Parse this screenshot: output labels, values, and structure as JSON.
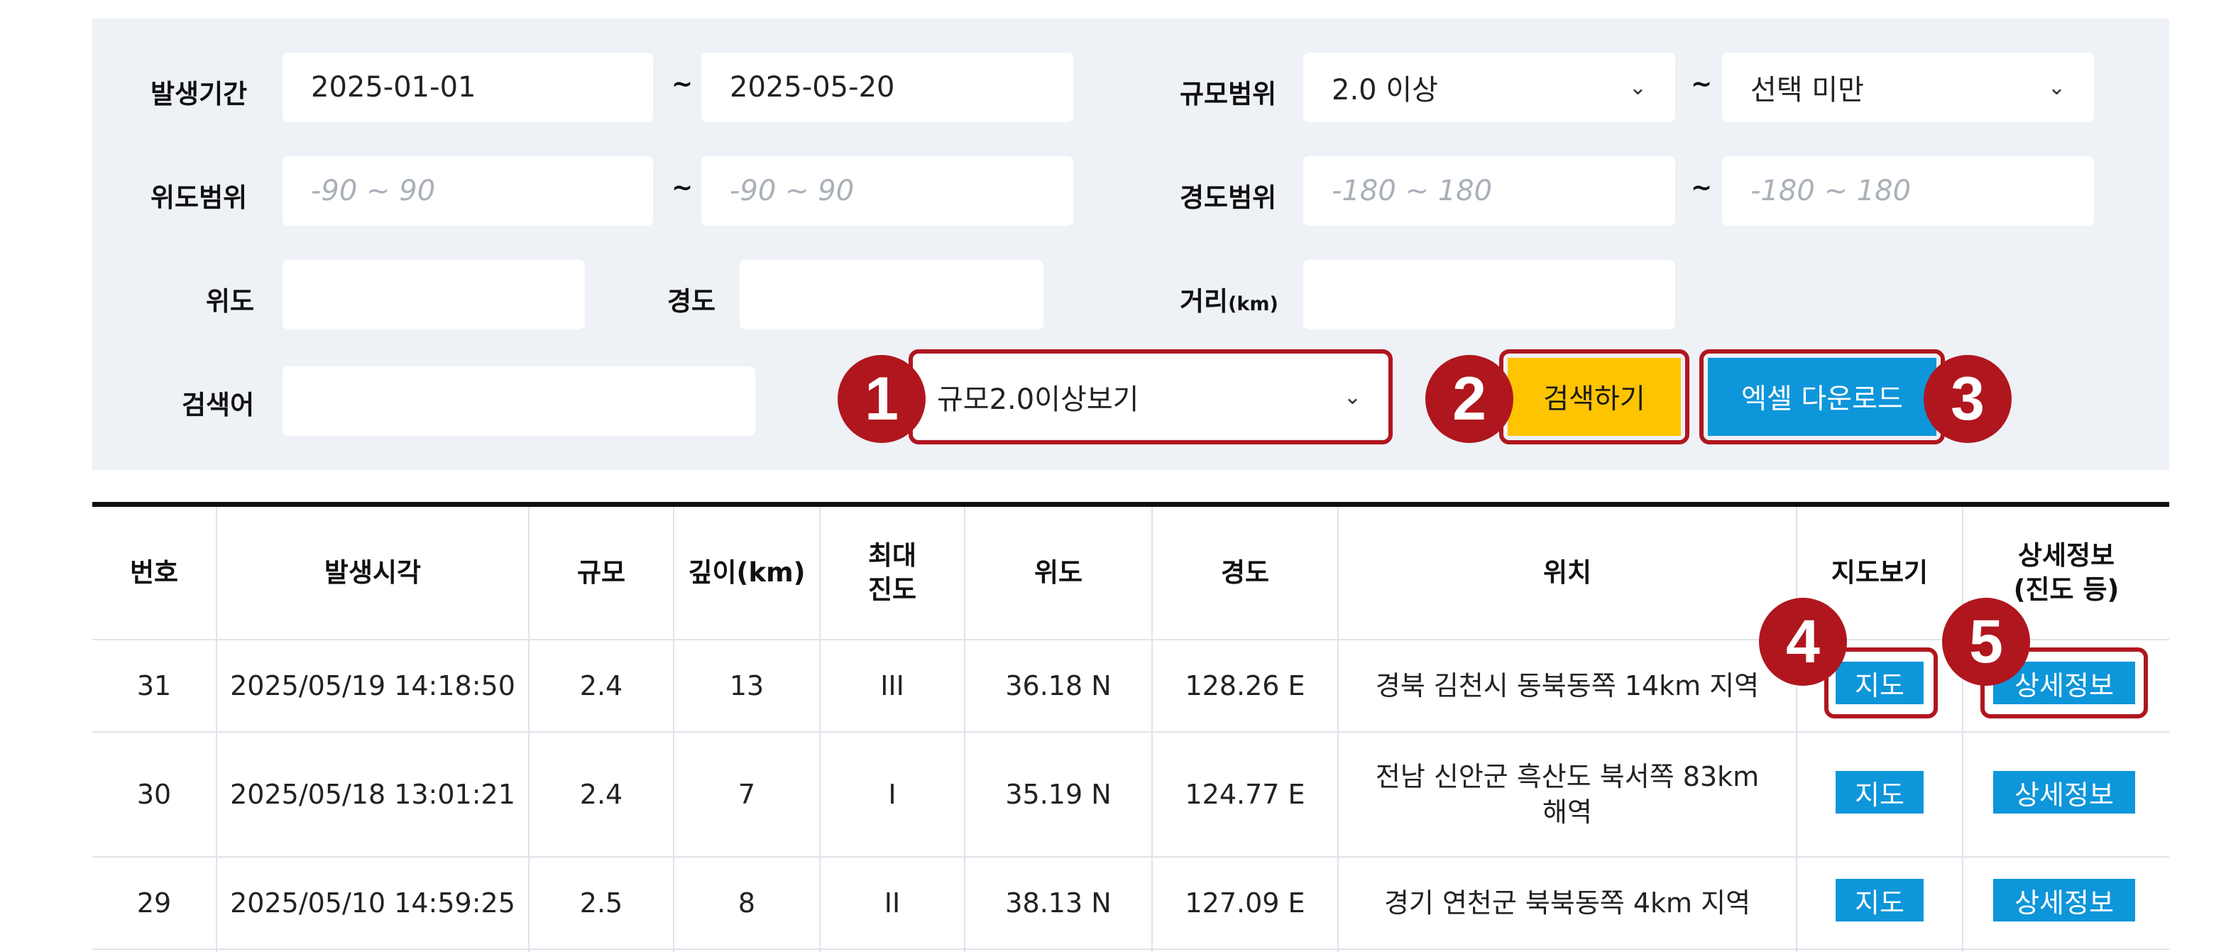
{
  "search": {
    "period_label": "발생기간",
    "period_from": "2025-01-01",
    "period_to": "2025-05-20",
    "magnitude_label": "규모범위",
    "magnitude_from": "2.0 이상",
    "magnitude_to": "선택 미만",
    "lat_range_label": "위도범위",
    "lat_from_placeholder": "-90 ~ 90",
    "lat_to_placeholder": "-90 ~ 90",
    "lon_range_label": "경도범위",
    "lon_from_placeholder": "-180 ~ 180",
    "lon_to_placeholder": "-180 ~ 180",
    "lat_label": "위도",
    "lon_label": "경도",
    "distance_label": "거리",
    "distance_unit": "(km)",
    "keyword_label": "검색어",
    "tilde": "~",
    "filter_select": "규모2.0이상보기",
    "search_button": "검색하기",
    "excel_button": "엑셀 다운로드"
  },
  "annotations": [
    "1",
    "2",
    "3",
    "4",
    "5"
  ],
  "table": {
    "headers": {
      "no": "번호",
      "time": "발생시각",
      "mag": "규모",
      "depth": "깊이(km)",
      "intensity_1": "최대",
      "intensity_2": "진도",
      "lat": "위도",
      "lon": "경도",
      "location": "위치",
      "map": "지도보기",
      "detail_1": "상세정보",
      "detail_2": "(진도 등)"
    },
    "rows": [
      {
        "no": "31",
        "time": "2025/05/19 14:18:50",
        "mag": "2.4",
        "depth": "13",
        "intensity": "III",
        "lat": "36.18 N",
        "lon": "128.26 E",
        "location": "경북 김천시 동북동쪽 14km 지역",
        "map": "지도",
        "detail": "상세정보"
      },
      {
        "no": "30",
        "time": "2025/05/18 13:01:21",
        "mag": "2.4",
        "depth": "7",
        "intensity": "I",
        "lat": "35.19 N",
        "lon": "124.77 E",
        "location": "전남 신안군 흑산도 북서쪽 83km 해역",
        "map": "지도",
        "detail": "상세정보"
      },
      {
        "no": "29",
        "time": "2025/05/10 14:59:25",
        "mag": "2.5",
        "depth": "8",
        "intensity": "II",
        "lat": "38.13 N",
        "lon": "127.09 E",
        "location": "경기 연천군 북북동쪽 4km 지역",
        "map": "지도",
        "detail": "상세정보"
      }
    ]
  },
  "colors": {
    "search_button": "#ffc400",
    "excel_button": "#0e96da",
    "highlight": "#b0161e",
    "panel": "#eef1f6"
  }
}
